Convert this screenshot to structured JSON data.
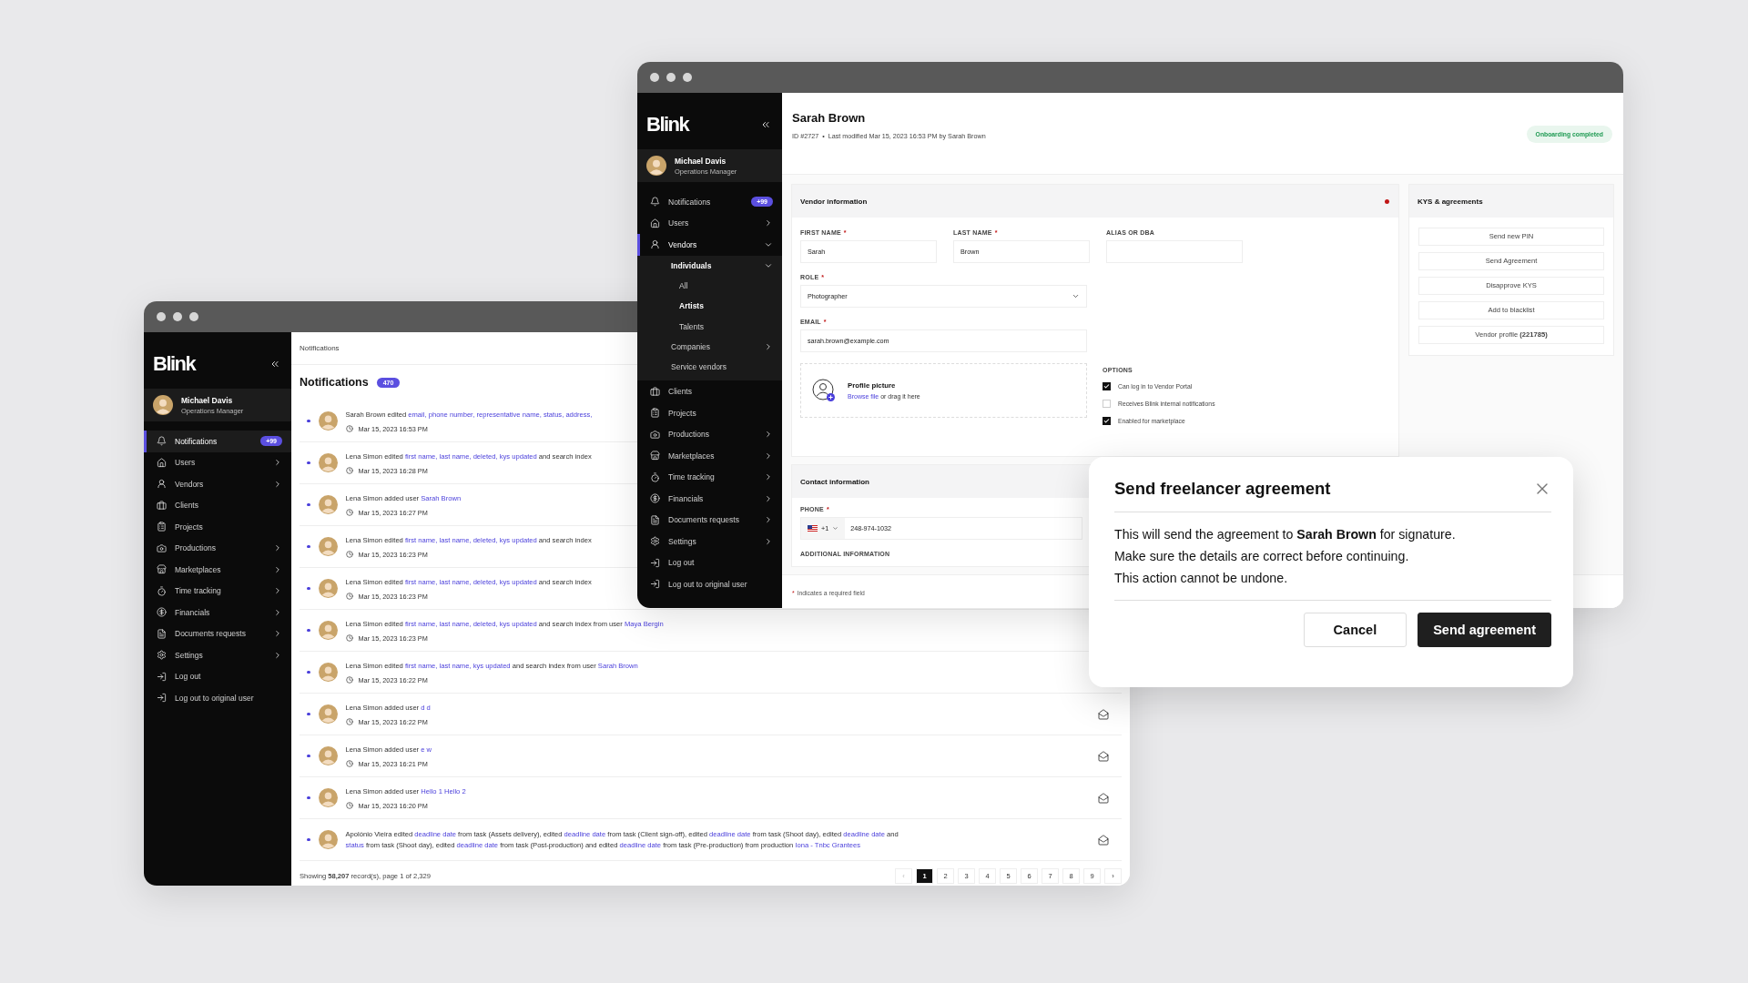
{
  "back_window": {
    "sidebar": {
      "logo": "Blink",
      "user": {
        "name": "Michael Davis",
        "role": "Operations Manager"
      },
      "items": [
        {
          "label": "Notifications",
          "selected": true,
          "badge": "+99"
        },
        {
          "label": "Users",
          "selected": false,
          "expanded": false
        },
        {
          "label": "Vendors",
          "selected": false,
          "expanded": false
        },
        {
          "label": "Clients",
          "selected": false
        },
        {
          "label": "Projects",
          "selected": false
        },
        {
          "label": "Productions",
          "selected": false,
          "expanded": false
        },
        {
          "label": "Marketplaces",
          "selected": false,
          "expanded": false
        },
        {
          "label": "Time tracking",
          "selected": false,
          "expanded": false
        },
        {
          "label": "Financials",
          "selected": false,
          "expanded": false
        },
        {
          "label": "Documents requests",
          "selected": false,
          "expanded": false
        },
        {
          "label": "Settings",
          "selected": false,
          "expanded": false
        },
        {
          "label": "Log out",
          "selected": false
        },
        {
          "label": "Log out to original user",
          "selected": false
        }
      ]
    },
    "breadcrumb": "Notifications",
    "title": "Notifications",
    "count": "470",
    "notifications": [
      {
        "unread": true,
        "time": "Mar 15, 2023 16:53 PM",
        "parts": [
          {
            "kind": "text",
            "text": "Sarah Brown edited "
          },
          {
            "kind": "link",
            "text": "email, phone number, representative name, status, address,"
          }
        ]
      },
      {
        "unread": true,
        "time": "Mar 15, 2023 16:28 PM",
        "parts": [
          {
            "kind": "text",
            "text": "Lena Simon edited "
          },
          {
            "kind": "link",
            "text": "first name, last name, deleted, kys updated"
          },
          {
            "kind": "text",
            "text": " and search index"
          }
        ]
      },
      {
        "unread": true,
        "time": "Mar 15, 2023 16:27 PM",
        "parts": [
          {
            "kind": "text",
            "text": "Lena Simon added user "
          },
          {
            "kind": "link",
            "text": "Sarah Brown"
          }
        ]
      },
      {
        "unread": true,
        "time": "Mar 15, 2023 16:23 PM",
        "parts": [
          {
            "kind": "text",
            "text": "Lena Simon edited "
          },
          {
            "kind": "link",
            "text": "first name, last name, deleted, kys updated"
          },
          {
            "kind": "text",
            "text": " and search index"
          }
        ]
      },
      {
        "unread": true,
        "time": "Mar 15, 2023 16:23 PM",
        "parts": [
          {
            "kind": "text",
            "text": "Lena Simon edited "
          },
          {
            "kind": "link",
            "text": "first name, last name, deleted, kys updated"
          },
          {
            "kind": "text",
            "text": " and search index"
          }
        ]
      },
      {
        "unread": true,
        "time": "Mar 15, 2023 16:23 PM",
        "parts": [
          {
            "kind": "text",
            "text": "Lena Simon edited "
          },
          {
            "kind": "link",
            "text": "first name, last name, deleted, kys updated"
          },
          {
            "kind": "text",
            "text": " and search index from user "
          },
          {
            "kind": "link",
            "text": "Maya Bergin"
          }
        ]
      },
      {
        "unread": true,
        "time": "Mar 15, 2023 16:22 PM",
        "parts": [
          {
            "kind": "text",
            "text": "Lena Simon edited "
          },
          {
            "kind": "link",
            "text": "first name, last name, kys updated"
          },
          {
            "kind": "text",
            "text": " and search index from user "
          },
          {
            "kind": "link",
            "text": "Sarah Brown"
          }
        ]
      },
      {
        "unread": true,
        "time": "Mar 15, 2023 16:22 PM",
        "parts": [
          {
            "kind": "text",
            "text": "Lena Simon added user "
          },
          {
            "kind": "link",
            "text": "d d"
          }
        ]
      },
      {
        "unread": true,
        "time": "Mar 15, 2023 16:21 PM",
        "parts": [
          {
            "kind": "text",
            "text": "Lena Simon added user "
          },
          {
            "kind": "link",
            "text": "e w"
          }
        ]
      },
      {
        "unread": true,
        "time": "Mar 15, 2023 16:20 PM",
        "parts": [
          {
            "kind": "text",
            "text": "Lena Simon added user "
          },
          {
            "kind": "link",
            "text": "Hello 1 Hello 2"
          }
        ]
      },
      {
        "unread": true,
        "parts": [
          {
            "kind": "text",
            "text": "Apolónio Vieira edited "
          },
          {
            "kind": "link",
            "text": "deadline date"
          },
          {
            "kind": "text",
            "text": " from task (Assets delivery), edited "
          },
          {
            "kind": "link",
            "text": "deadline date"
          },
          {
            "kind": "text",
            "text": " from task (Client sign-off), edited "
          },
          {
            "kind": "link",
            "text": "deadline date"
          },
          {
            "kind": "text",
            "text": " from task (Shoot day), edited "
          },
          {
            "kind": "link",
            "text": "deadline date"
          },
          {
            "kind": "text",
            "text": " and "
          },
          {
            "kind": "link",
            "text": "status"
          },
          {
            "kind": "text",
            "text": " from task (Shoot day), edited "
          },
          {
            "kind": "link",
            "text": "deadline date"
          },
          {
            "kind": "text",
            "text": " from task (Post-production) and edited "
          },
          {
            "kind": "link",
            "text": "deadline date"
          },
          {
            "kind": "text",
            "text": " from task (Pre-production) from production "
          },
          {
            "kind": "link",
            "text": "Iona - Tnbc Grantees"
          }
        ]
      }
    ],
    "footer": "Showing **58,207** record(s), page 1 of 2,329",
    "pagination": {
      "prev": {
        "label": "‹",
        "disabled": true
      },
      "next": {
        "label": "›",
        "disabled": false
      },
      "pages": [
        {
          "label": "1",
          "selected": true
        },
        {
          "label": "2",
          "selected": false
        },
        {
          "label": "3",
          "selected": false
        },
        {
          "label": "4",
          "selected": false
        },
        {
          "label": "5",
          "selected": false
        },
        {
          "label": "6",
          "selected": false
        },
        {
          "label": "7",
          "selected": false
        },
        {
          "label": "8",
          "selected": false
        },
        {
          "label": "9",
          "selected": false
        }
      ]
    }
  },
  "front_window": {
    "sidebar": {
      "logo": "Blink",
      "user": {
        "name": "Michael Davis",
        "role": "Operations Manager"
      },
      "items": [
        {
          "label": "Notifications",
          "selected": false,
          "badge": "+99"
        },
        {
          "label": "Users",
          "selected": false,
          "expanded": false
        },
        {
          "label": "Vendors",
          "selected": true,
          "expanded": true,
          "children": [
            {
              "label": "Individuals",
              "selected": false,
              "expanded": true,
              "children": [
                {
                  "label": "All",
                  "selected": false
                },
                {
                  "label": "Artists",
                  "selected": true
                },
                {
                  "label": "Talents",
                  "selected": false
                }
              ]
            },
            {
              "label": "Companies",
              "selected": false,
              "expanded": false
            },
            {
              "label": "Service vendors",
              "selected": false
            }
          ]
        },
        {
          "label": "Clients",
          "selected": false
        },
        {
          "label": "Projects",
          "selected": false
        },
        {
          "label": "Productions",
          "selected": false,
          "expanded": false
        },
        {
          "label": "Marketplaces",
          "selected": false,
          "expanded": false
        },
        {
          "label": "Time tracking",
          "selected": false,
          "expanded": false
        },
        {
          "label": "Financials",
          "selected": false,
          "expanded": false
        },
        {
          "label": "Documents requests",
          "selected": false,
          "expanded": false
        },
        {
          "label": "Settings",
          "selected": false,
          "expanded": false
        },
        {
          "label": "Log out",
          "selected": false
        },
        {
          "label": "Log out to original user",
          "selected": false
        }
      ]
    },
    "title": "Sarah Brown",
    "meta": "ID #2727  •  Last modified Mar 15, 2023 16:53 PM by Sarah Brown",
    "status": "Onboarding completed",
    "required_mark": "*",
    "vendor_panel": {
      "title": "Vendor information",
      "unsaved": true,
      "fields": [
        {
          "label": "FIRST NAME",
          "required": true,
          "value": "Sarah"
        },
        {
          "label": "LAST NAME",
          "required": true,
          "value": "Brown"
        },
        {
          "label": "ALIAS OR DBA",
          "required": false
        }
      ],
      "role": {
        "label": "ROLE",
        "required": true,
        "value": "Photographer"
      },
      "email": {
        "label": "EMAIL",
        "required": true,
        "value": "sarah.brown@example.com"
      },
      "profile": {
        "title": "Profile picture",
        "link": "Browse file",
        "hint": " or drag it here"
      },
      "options": {
        "label": "OPTIONS",
        "items": [
          {
            "label": "Can log in to Vendor Portal",
            "checked": true
          },
          {
            "label": "Receives Blink internal notifications",
            "checked": false
          },
          {
            "label": "Enabled for marketplace",
            "checked": true
          }
        ]
      }
    },
    "contact_panel": {
      "title": "Contact information",
      "phone": {
        "label": "PHONE",
        "required": true,
        "country_code": "+1",
        "value": "248-974-1032"
      },
      "additional_label": "ADDITIONAL INFORMATION"
    },
    "required_note": "Indicates a required field",
    "kys_panel": {
      "title": "KYS & agreements",
      "buttons": [
        "Send new PIN",
        "Send Agreement",
        "Disapprove KYS",
        "Add to blacklist",
        "Vendor profile **(221785)**"
      ]
    }
  },
  "modal": {
    "title": "Send freelancer agreement",
    "lines": [
      "This will send the agreement to **Sarah Brown** for signature.",
      "Make sure the details are correct before continuing.",
      "This action cannot be undone."
    ],
    "cancel": "Cancel",
    "confirm": "Send agreement"
  }
}
